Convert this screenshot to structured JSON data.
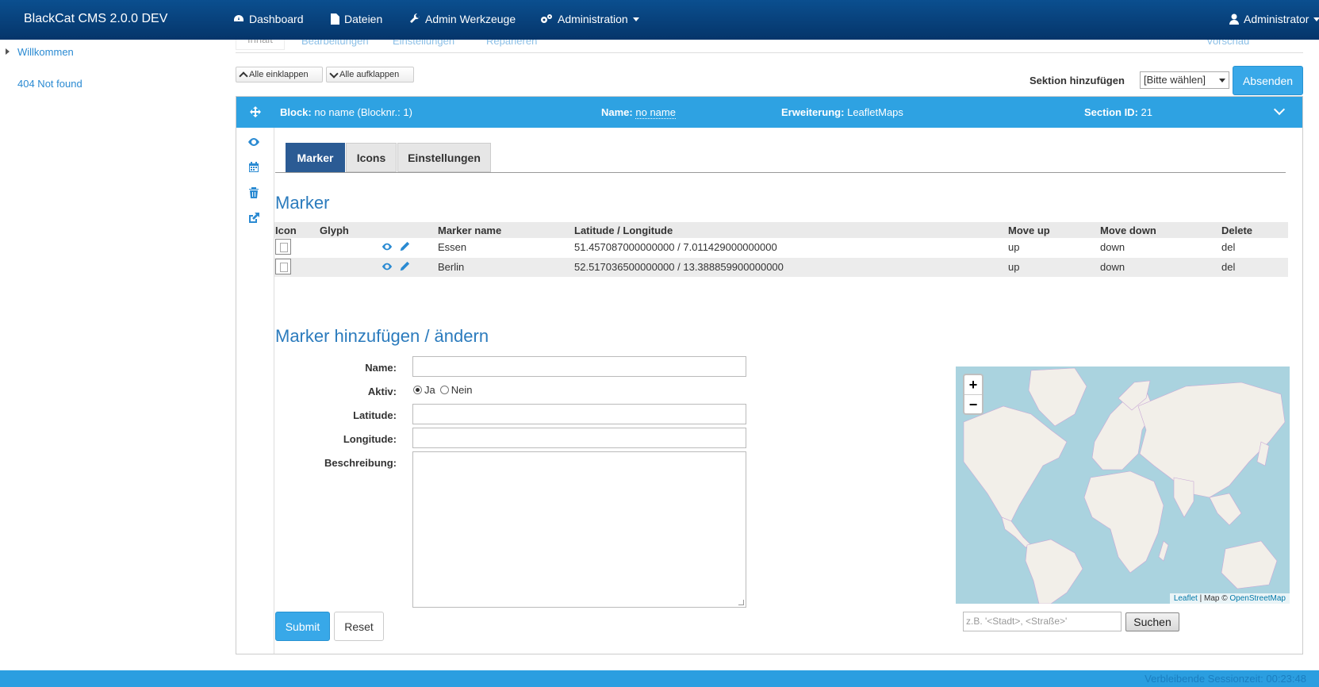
{
  "navbar": {
    "brand": "BlackCat CMS 2.0.0 DEV",
    "items": [
      {
        "label": "Dashboard",
        "icon": "dashboard-icon"
      },
      {
        "label": "Dateien",
        "icon": "file-icon"
      },
      {
        "label": "Admin Werkzeuge",
        "icon": "wrench-icon"
      },
      {
        "label": "Administration",
        "icon": "gears-icon"
      }
    ],
    "user": "Administrator"
  },
  "sidebar": {
    "items": [
      {
        "label": "Willkommen"
      },
      {
        "label": "404 Not found"
      }
    ]
  },
  "page_tabs": [
    "Inhalt",
    "Bearbeitungen",
    "Einstellungen",
    "Reparieren",
    "Vorschau"
  ],
  "toolbar": {
    "collapse_all": "Alle einklappen",
    "expand_all": "Alle aufklappen",
    "add_section_label": "Sektion hinzufügen",
    "add_section_value": "[Bitte wählen]",
    "send_label": "Absenden"
  },
  "block": {
    "block_label": "Block:",
    "block_value": "no name (Blocknr.: 1)",
    "name_label": "Name:",
    "name_value": "no name",
    "extension_label": "Erweiterung:",
    "extension_value": "LeafletMaps",
    "section_label": "Section ID:",
    "section_value": "21"
  },
  "inner_tabs": [
    "Marker",
    "Icons",
    "Einstellungen"
  ],
  "marker_title": "Marker",
  "table": {
    "headers": [
      "Icon",
      "Glyph",
      "Marker name",
      "Latitude / Longitude",
      "Move up",
      "Move down",
      "Delete"
    ],
    "rows": [
      {
        "name": "Essen",
        "coords": "51.457087000000000 / 7.011429000000000",
        "up": "up",
        "down": "down",
        "del": "del"
      },
      {
        "name": "Berlin",
        "coords": "52.517036500000000 / 13.388859900000000",
        "up": "up",
        "down": "down",
        "del": "del"
      }
    ]
  },
  "form": {
    "title": "Marker hinzufügen / ändern",
    "name_label": "Name:",
    "active_label": "Aktiv:",
    "active_yes": "Ja",
    "active_no": "Nein",
    "latitude_label": "Latitude:",
    "longitude_label": "Longitude:",
    "description_label": "Beschreibung:",
    "submit": "Submit",
    "reset": "Reset"
  },
  "map": {
    "zoom_in": "+",
    "zoom_out": "−",
    "attribution_leaflet": "Leaflet",
    "attribution_sep": " | Map © ",
    "attribution_osm": "OpenStreetMap",
    "search_placeholder": "z.B. '<Stadt>, <Straße>'",
    "search_button": "Suchen"
  },
  "footer": {
    "session_text": "Verbleibende Sessionzeit: 00:23:48"
  },
  "colors": {
    "navbar": "#05356a",
    "panel_header": "#2ea2e2",
    "accent": "#2a8ad2",
    "active_tab": "#2b5b94",
    "map_water": "#aad3df"
  }
}
